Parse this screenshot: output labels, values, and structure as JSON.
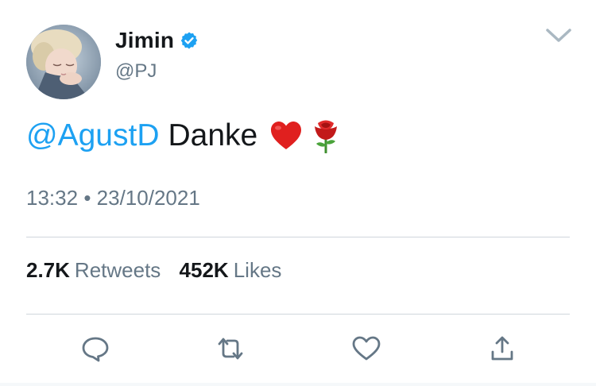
{
  "author": {
    "name": "Jimin",
    "handle": "@PJ",
    "verified": true
  },
  "tweet": {
    "mention": "@AgustD",
    "text": "Danke",
    "emojis": [
      "heart-emoji",
      "rose-emoji"
    ]
  },
  "meta": {
    "time": "13:32",
    "separator": "•",
    "date": "23/10/2021"
  },
  "stats": {
    "retweets_count": "2.7K",
    "retweets_label": "Retweets",
    "likes_count": "452K",
    "likes_label": "Likes"
  },
  "actions": [
    "reply-icon",
    "retweet-icon",
    "like-icon",
    "share-icon"
  ],
  "colors": {
    "link": "#1da1f2",
    "secondary_text": "#657786",
    "primary_text": "#14171a",
    "divider": "#cfd6dc",
    "icon": "#657786"
  }
}
